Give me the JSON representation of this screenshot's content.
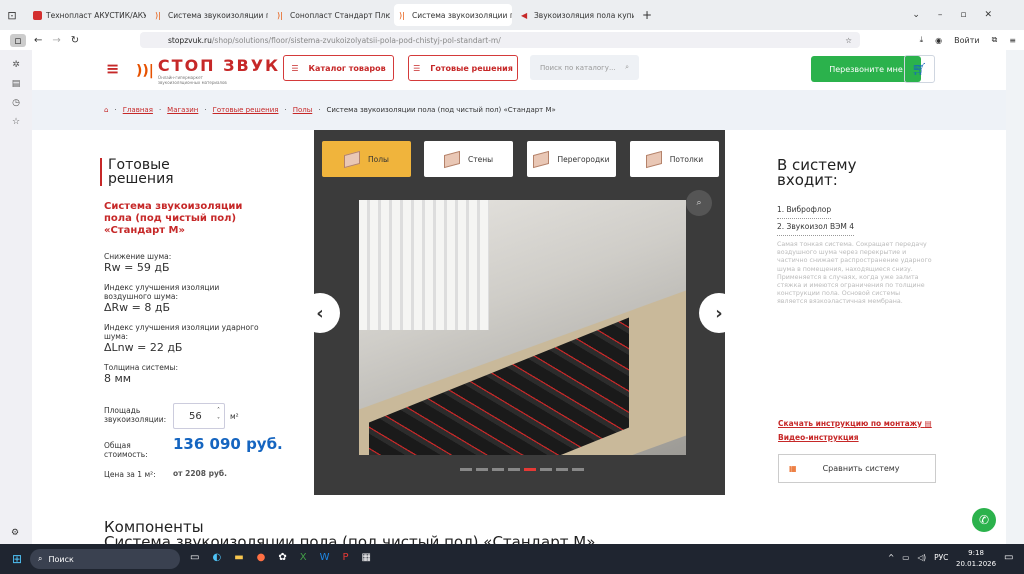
{
  "browser": {
    "tabs": [
      {
        "label": "Технопласт АКУСТИК/АКУСТИК",
        "icon": "tn-icon"
      },
      {
        "label": "Система звукоизоляции пола",
        "icon": "stopzvuk-icon"
      },
      {
        "label": "Сонопласт Стандарт Плюс — з",
        "icon": "stopzvuk-icon"
      },
      {
        "label": "Система звукоизоляции пола",
        "icon": "stopzvuk-icon",
        "active": true
      },
      {
        "label": "Звукоизоляция пола купить м",
        "icon": "speaker-icon"
      }
    ],
    "url_domain": "stopzvuk.ru",
    "url_path": "/shop/solutions/floor/sistema-zvukoizolyatsii-pola-pod-chistyj-pol-standart-m/",
    "login": "Войти"
  },
  "header": {
    "logo": "СТОП ЗВУК",
    "logo_sub": "Онлайн-гипермаркет звукоизоляционных материалов",
    "catalog": "Каталог товаров",
    "solutions": "Готовые решения",
    "search_placeholder": "Поиск по каталогу...",
    "callback": "Перезвоните мне"
  },
  "breadcrumbs": [
    "Главная",
    "Магазин",
    "Готовые решения",
    "Полы"
  ],
  "breadcrumb_current": "Система звукоизоляции пола (под чистый пол) «Стандарт М»",
  "left": {
    "heading1": "Готовые",
    "heading2": "решения",
    "title": "Система звукоизоляции пола (под чистый пол) «Стандарт М»",
    "noise_label": "Снижение шума:",
    "noise_val": "Rw = 59 дБ",
    "air_label": "Индекс улучшения изоляции воздушного шума:",
    "air_val": "ΔRw = 8 дБ",
    "impact_label": "Индекс улучшения изоляции ударного шума:",
    "impact_val": "ΔLnw = 22 дБ",
    "thick_label": "Толщина системы:",
    "thick_val": "8 мм",
    "area_label": "Площадь звукоизоляции:",
    "area_val": "56",
    "area_unit": "м²",
    "total_label": "Общая стоимость:",
    "total_val": "136 090 руб.",
    "unit_label": "Цена за 1 м²:",
    "unit_val": "от 2208 руб."
  },
  "gallery": {
    "tabs": [
      "Полы",
      "Стены",
      "Перегородки",
      "Потолки"
    ],
    "slides": 8,
    "active_slide": 5
  },
  "right": {
    "heading": "В систему входит:",
    "items": [
      "1. Виброфлор",
      "2. Звукоизол ВЭМ 4"
    ],
    "desc": "Самая тонкая система. Сокращает передачу воздушного шума через перекрытие и частично снижает распространение ударного шума в помещения, находящиеся снизу. Применяется в случаях, когда уже залита стяжка и имеются ограничения по толщине конструкции пола. Основой системы является вязкоэластичная мембрана.",
    "install": "Скачать инструкцию по монтажу",
    "video": "Видео-инструкция",
    "compare": "Сравнить систему"
  },
  "components": {
    "line1": "Компоненты",
    "line2": "Система звукоизоляции пола (под чистый пол) «Стандарт М»"
  },
  "taskbar": {
    "search": "Поиск",
    "lang": "РУС",
    "time": "9:18",
    "date": "20.01.2026"
  },
  "colors": {
    "accent": "#c62828",
    "green": "#2bb24c",
    "blue": "#1565c0"
  }
}
